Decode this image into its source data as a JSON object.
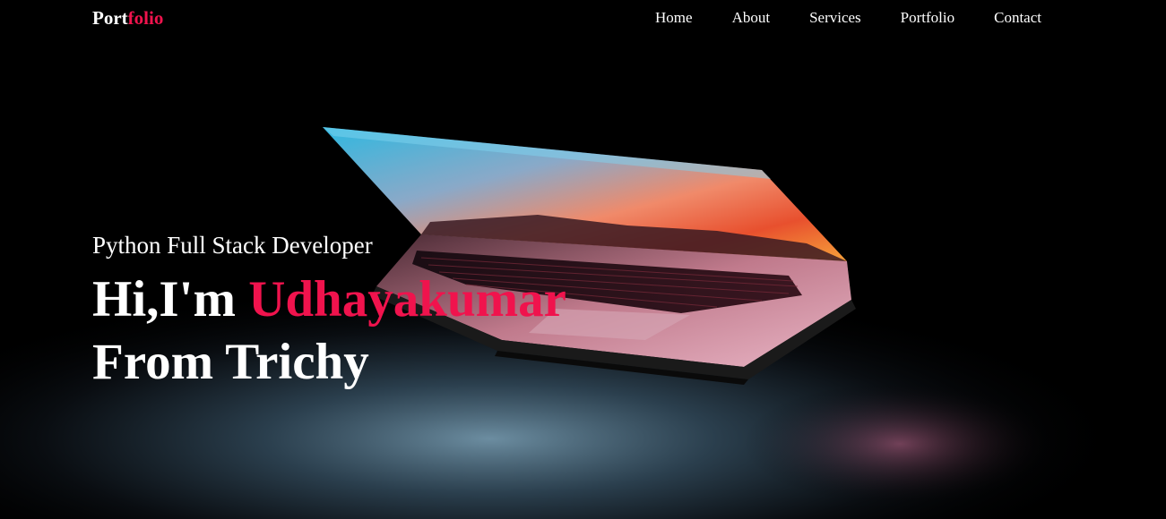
{
  "nav": {
    "logo_part1": "Port",
    "logo_part2": "folio",
    "items": [
      {
        "label": "Home"
      },
      {
        "label": "About"
      },
      {
        "label": "Services"
      },
      {
        "label": "Portfolio"
      },
      {
        "label": "Contact"
      }
    ]
  },
  "hero": {
    "subtitle": "Python Full Stack Developer",
    "greeting": "Hi,I'm ",
    "name": "Udhayakumar",
    "line2": "From Trichy"
  },
  "colors": {
    "accent": "#f0134d",
    "background": "#000000",
    "text": "#ffffff"
  }
}
